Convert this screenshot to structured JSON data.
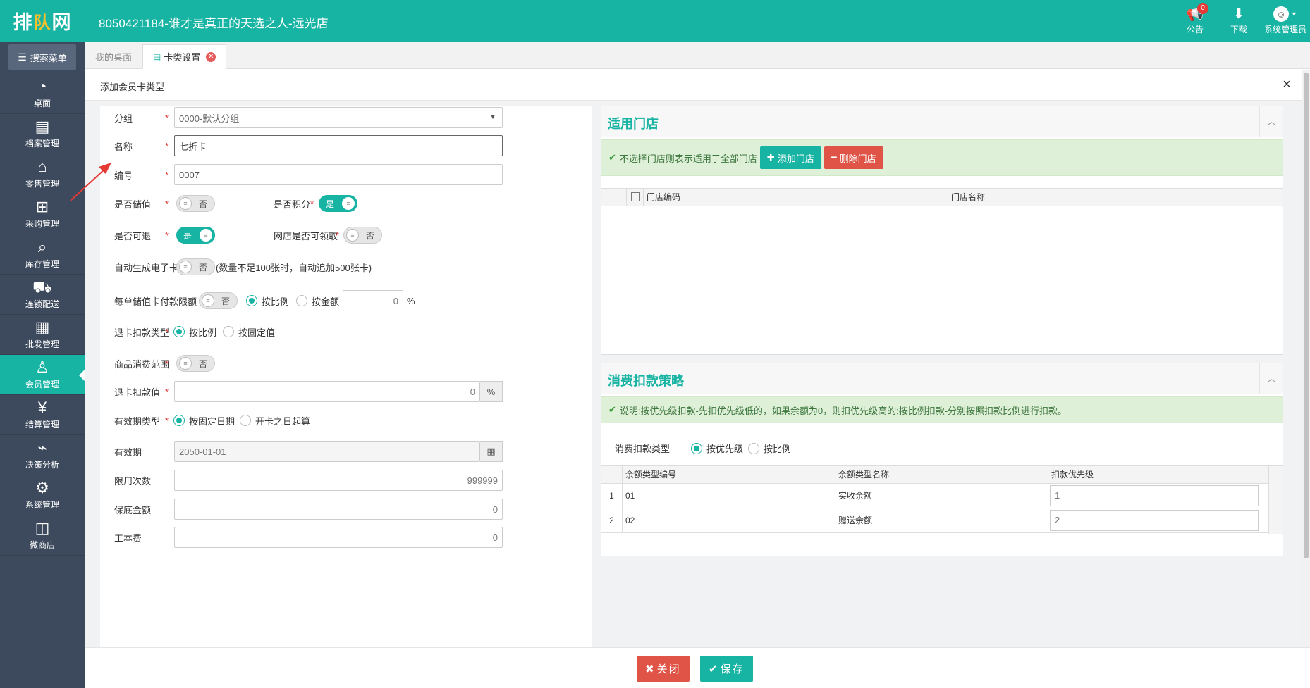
{
  "brand": {
    "logo_left": "排",
    "logo_mid": "队",
    "logo_right": "网"
  },
  "header": {
    "title": "8050421184-谁才是真正的天选之人-远光店",
    "notice_label": "公告",
    "notice_count": "0",
    "download_label": "下载",
    "user_label": "系统管理员"
  },
  "sidebar": {
    "search_label": "搜索菜单",
    "items": [
      {
        "label": "桌面",
        "icon": "dashboard-icon"
      },
      {
        "label": "档案管理",
        "icon": "archive-icon"
      },
      {
        "label": "零售管理",
        "icon": "store-icon"
      },
      {
        "label": "采购管理",
        "icon": "cart-icon"
      },
      {
        "label": "库存管理",
        "icon": "inventory-search-icon"
      },
      {
        "label": "连锁配送",
        "icon": "truck-icon"
      },
      {
        "label": "批发管理",
        "icon": "wholesale-icon"
      },
      {
        "label": "会员管理",
        "icon": "member-icon"
      },
      {
        "label": "结算管理",
        "icon": "settlement-icon"
      },
      {
        "label": "决策分析",
        "icon": "chart-icon"
      },
      {
        "label": "系统管理",
        "icon": "gear-icon"
      },
      {
        "label": "微商店",
        "icon": "bag-icon"
      }
    ],
    "active_index": 7
  },
  "tabs": [
    {
      "label": "我的桌面"
    },
    {
      "label": "卡类设置"
    }
  ],
  "dialog": {
    "title": "添加会员卡类型",
    "close_symbol": "×"
  },
  "form": {
    "group": {
      "label": "分组",
      "value": "0000-默认分组"
    },
    "name": {
      "label": "名称",
      "value": "七折卡"
    },
    "code": {
      "label": "编号",
      "value": "0007"
    },
    "stored_value": {
      "label": "是否储值",
      "state": "否"
    },
    "points": {
      "label": "是否积分",
      "state": "是"
    },
    "refundable": {
      "label": "是否可退",
      "state": "是"
    },
    "online_claim": {
      "label": "网店是否可领取",
      "state": "否"
    },
    "auto_ecard": {
      "label": "自动生成电子卡",
      "state": "否",
      "note": "(数量不足100张时，自动追加500张卡)"
    },
    "pay_limit": {
      "label": "每单储值卡付款限额",
      "state": "否",
      "opt1": "按比例",
      "opt2": "按金额",
      "value": "0",
      "unit": "%"
    },
    "refund_type": {
      "label": "退卡扣款类型",
      "opt1": "按比例",
      "opt2": "按固定值"
    },
    "scope": {
      "label": "商品消费范围",
      "state": "否"
    },
    "refund_value": {
      "label": "退卡扣款值",
      "value": "0",
      "unit": "%"
    },
    "validity_type": {
      "label": "有效期类型",
      "opt1": "按固定日期",
      "opt2": "开卡之日起算"
    },
    "validity": {
      "label": "有效期",
      "value": "2050-01-01"
    },
    "use_limit": {
      "label": "限用次数",
      "value": "999999"
    },
    "min_amount": {
      "label": "保底金额",
      "value": "0"
    },
    "labor_fee": {
      "label": "工本费",
      "value": "0"
    }
  },
  "stores_panel": {
    "title": "适用门店",
    "alert": "不选择门店则表示适用于全部门店",
    "add_button": "添加门店",
    "delete_button": "删除门店",
    "col_code": "门店编码",
    "col_name": "门店名称"
  },
  "deduct_panel": {
    "title": "消费扣款策略",
    "alert": "说明:按优先级扣款-先扣优先级低的，如果余额为0，则扣优先级高的;按比例扣款-分别按照扣款比例进行扣款。",
    "type_label": "消费扣款类型",
    "opt1": "按优先级",
    "opt2": "按比例",
    "columns": [
      "余额类型编号",
      "余额类型名称",
      "扣款优先级"
    ],
    "rows": [
      {
        "num": "1",
        "code": "01",
        "name": "实收余额",
        "priority": "1"
      },
      {
        "num": "2",
        "code": "02",
        "name": "赠送余额",
        "priority": "2"
      }
    ]
  },
  "footer": {
    "close_button": "关闭",
    "save_button": "保存"
  },
  "colors": {
    "brand": "#17b3a3",
    "sidebar": "#3d4a5d",
    "danger": "#df5446"
  }
}
